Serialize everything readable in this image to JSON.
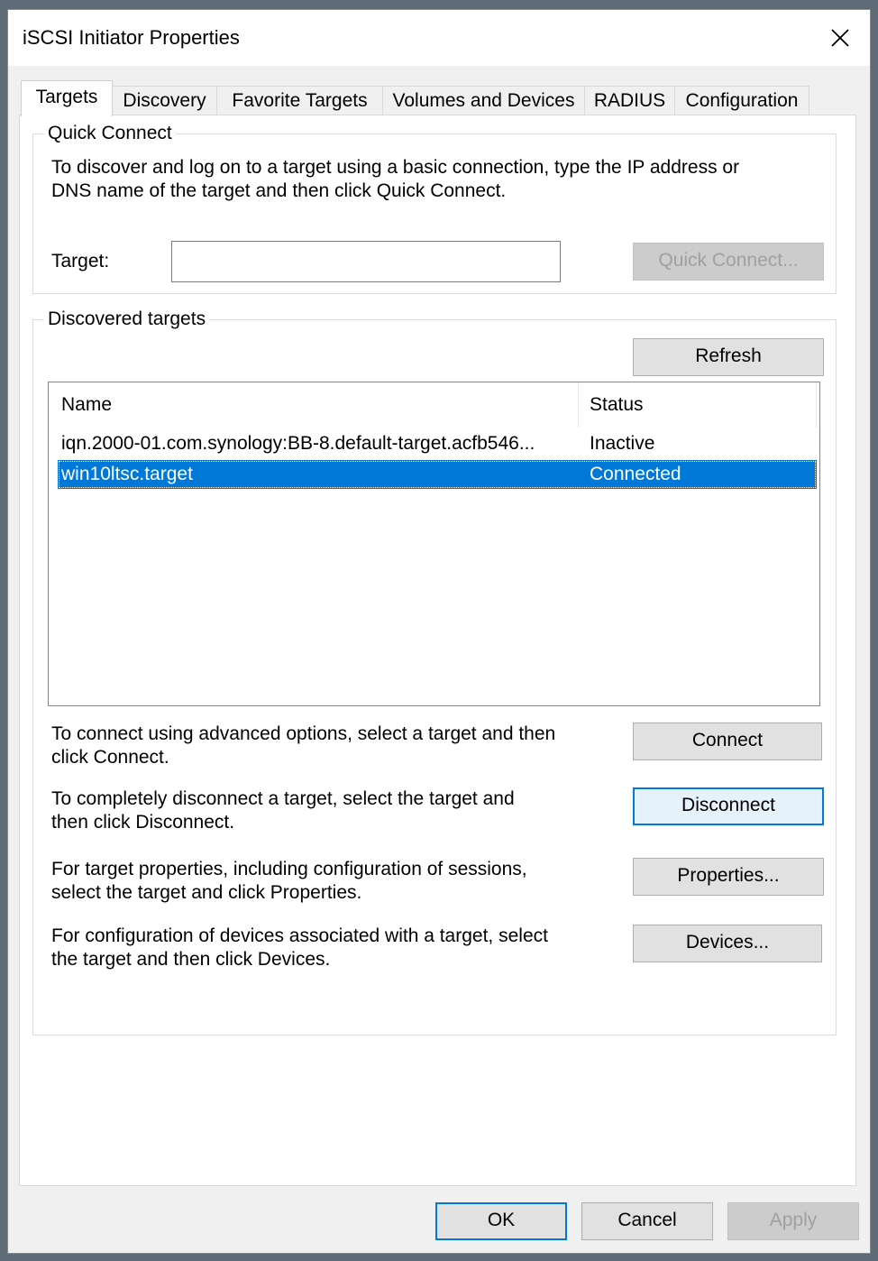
{
  "window": {
    "title": "iSCSI Initiator Properties"
  },
  "tabs": [
    {
      "label": "Targets"
    },
    {
      "label": "Discovery"
    },
    {
      "label": "Favorite Targets"
    },
    {
      "label": "Volumes and Devices"
    },
    {
      "label": "RADIUS"
    },
    {
      "label": "Configuration"
    }
  ],
  "quick_connect": {
    "title": "Quick Connect",
    "description_line1": "To discover and log on to a target using a basic connection, type the IP address or",
    "description_line2": "DNS name of the target and then click Quick Connect.",
    "target_label": "Target:",
    "target_value": "",
    "button_label": "Quick Connect..."
  },
  "discovered": {
    "title": "Discovered targets",
    "refresh_label": "Refresh",
    "columns": {
      "name": "Name",
      "status": "Status"
    },
    "rows": [
      {
        "name": "iqn.2000-01.com.synology:BB-8.default-target.acfb546...",
        "status": "Inactive"
      },
      {
        "name": "win10ltsc.target",
        "status": "Connected"
      }
    ],
    "selected_index": 1,
    "connect": {
      "line1": "To connect using advanced options, select a target and then",
      "line2": "click Connect.",
      "button": "Connect"
    },
    "disconnect": {
      "line1": "To completely disconnect a target, select the target and",
      "line2": "then click Disconnect.",
      "button": "Disconnect"
    },
    "properties": {
      "line1": "For target properties, including configuration of sessions,",
      "line2": "select the target and click Properties.",
      "button": "Properties..."
    },
    "devices": {
      "line1": "For configuration of devices associated with a target, select",
      "line2": "the target and then click Devices.",
      "button": "Devices..."
    }
  },
  "footer": {
    "ok": "OK",
    "cancel": "Cancel",
    "apply": "Apply"
  },
  "colors": {
    "accent": "#0078d7",
    "selection": "#0078d7"
  },
  "icons": {
    "close": "close-icon"
  }
}
